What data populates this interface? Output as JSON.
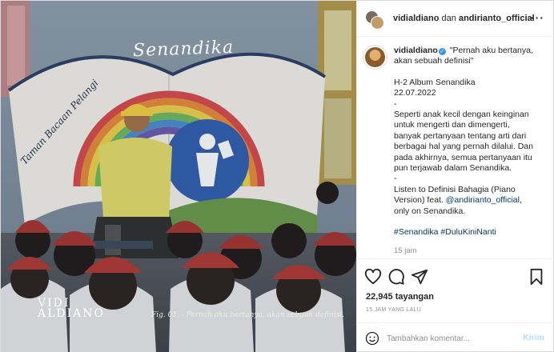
{
  "media": {
    "wall_title": "Senandika",
    "wall_sign": "Taman Bacaan Pelangi",
    "brand": "VIDI\nALDIANO",
    "brand_line1": "VIDI",
    "brand_line2": "ALDIANO",
    "figure_caption": "Fig. 01. - Pernah aku bertanya, akan sebuah definisi."
  },
  "header": {
    "user1": "vidialdiano",
    "joiner": "dan",
    "user2": "andirianto_official",
    "more_icon": "more-horizontal-icon"
  },
  "caption": {
    "username": "vidialdiano",
    "verified_icon": "verified-badge-icon",
    "lines": [
      "\"Pernah aku bertanya,",
      "akan sebuah definisi\""
    ],
    "album_line": "H-2 Album Senandika",
    "date_line": "22.07.2022",
    "dash1": "-",
    "para": [
      "Seperti anak kecil dengan keinginan",
      "untuk mengerti dan dimengerti,",
      "banyak pertanyaan tentang arti dari",
      "berbagai hal yang pernah dilalui. Dan",
      "pada akhirnya, semua pertanyaan itu",
      "pun terjawab dalam Senandika."
    ],
    "dash2": "-",
    "listen1": "Listen to Definisi Bahagia (Piano",
    "listen2_prefix": "Version) feat. ",
    "listen2_mention": "@andirianto_official",
    "listen2_suffix": ",",
    "listen3": "only on Senandika.",
    "hashtag1": "#Senandika",
    "hashtag2": "#DuluKiniNanti",
    "time_ago": "15 jam"
  },
  "actions": {
    "like_icon": "heart-icon",
    "comment_icon": "comment-icon",
    "share_icon": "share-icon",
    "save_icon": "bookmark-icon",
    "views": "22,945 tayangan",
    "posted": "15 JAM YANG LALU"
  },
  "comment": {
    "emoji_icon": "smile-icon",
    "placeholder": "Tambahkan komentar...",
    "post_label": "Kirim"
  },
  "colors": {
    "link": "#00376b",
    "verified": "#3897f0",
    "post_disabled": "#b3dbff",
    "secondary_text": "#8e8e8e"
  }
}
